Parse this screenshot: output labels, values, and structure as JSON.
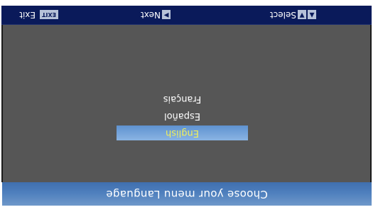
{
  "header": {
    "title": "Choose your menu Language"
  },
  "languages": [
    {
      "label": "English",
      "selected": true
    },
    {
      "label": "Español",
      "selected": false
    },
    {
      "label": "Français",
      "selected": false
    }
  ],
  "footer": {
    "select": {
      "keys": [
        "▲",
        "▼"
      ],
      "label": "Select"
    },
    "next": {
      "key": "▶",
      "label": "Next"
    },
    "exit": {
      "key": "EXIT",
      "label": "Exit"
    }
  },
  "colors": {
    "header": "#4e7fbd",
    "body": "#565656",
    "footer": "#0a1a5a",
    "selected_text": "#f2ef5a"
  }
}
